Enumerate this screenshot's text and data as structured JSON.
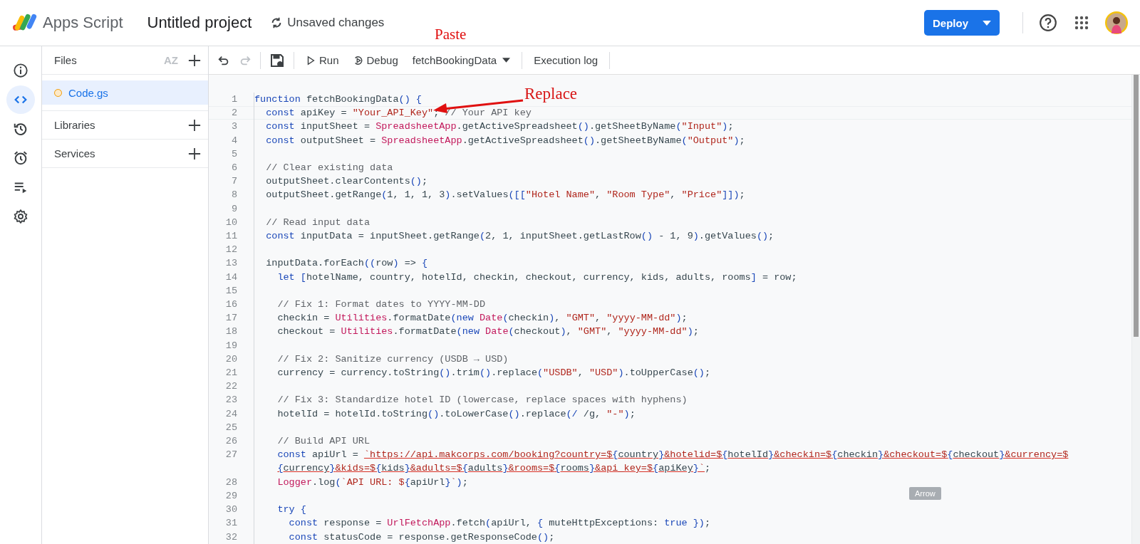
{
  "header": {
    "app_name": "Apps Script",
    "project_title": "Untitled project",
    "save_status": "Unsaved changes",
    "deploy_button": "Deploy"
  },
  "rail": [
    {
      "kind": "info",
      "selected": false
    },
    {
      "kind": "code",
      "selected": true
    },
    {
      "kind": "history",
      "selected": false
    },
    {
      "kind": "triggers",
      "selected": false
    },
    {
      "kind": "executions",
      "selected": false
    },
    {
      "kind": "settings",
      "selected": false
    }
  ],
  "files_panel": {
    "title": "Files",
    "sort_label": "AZ",
    "files": [
      {
        "name": "Code.gs",
        "selected": true
      }
    ],
    "sections": [
      {
        "label": "Libraries"
      },
      {
        "label": "Services"
      }
    ]
  },
  "toolbar": {
    "undo_disabled": false,
    "redo_disabled": true,
    "run": "Run",
    "debug": "Debug",
    "function_select": "fetchBookingData",
    "execution_log": "Execution log"
  },
  "code_lines": [
    {
      "number": "1",
      "current": false,
      "rows": [
        [
          {
            "kind": "keyword",
            "text": "function "
          },
          {
            "kind": "plain",
            "text": "fetchBookingData"
          },
          {
            "kind": "brace",
            "text": "() {"
          }
        ]
      ]
    },
    {
      "number": "2",
      "current": true,
      "rows": [
        [
          {
            "kind": "plain",
            "text": "  "
          },
          {
            "kind": "keyword",
            "text": "const "
          },
          {
            "kind": "plain",
            "text": "apiKey = "
          },
          {
            "kind": "string",
            "text": "\"Your_API_Key\""
          },
          {
            "kind": "plain",
            "text": "; "
          },
          {
            "kind": "comment",
            "text": "// Your API key"
          }
        ]
      ]
    },
    {
      "number": "3",
      "current": false,
      "rows": [
        [
          {
            "kind": "plain",
            "text": "  "
          },
          {
            "kind": "keyword",
            "text": "const "
          },
          {
            "kind": "plain",
            "text": "inputSheet = "
          },
          {
            "kind": "class",
            "text": "SpreadsheetApp"
          },
          {
            "kind": "plain",
            "text": ".getActiveSpreadsheet"
          },
          {
            "kind": "brace",
            "text": "()"
          },
          {
            "kind": "plain",
            "text": ".getSheetByName"
          },
          {
            "kind": "brace",
            "text": "("
          },
          {
            "kind": "string",
            "text": "\"Input\""
          },
          {
            "kind": "brace",
            "text": ")"
          },
          {
            "kind": "plain",
            "text": ";"
          }
        ]
      ]
    },
    {
      "number": "4",
      "current": false,
      "rows": [
        [
          {
            "kind": "plain",
            "text": "  "
          },
          {
            "kind": "keyword",
            "text": "const "
          },
          {
            "kind": "plain",
            "text": "outputSheet = "
          },
          {
            "kind": "class",
            "text": "SpreadsheetApp"
          },
          {
            "kind": "plain",
            "text": ".getActiveSpreadsheet"
          },
          {
            "kind": "brace",
            "text": "()"
          },
          {
            "kind": "plain",
            "text": ".getSheetByName"
          },
          {
            "kind": "brace",
            "text": "("
          },
          {
            "kind": "string",
            "text": "\"Output\""
          },
          {
            "kind": "brace",
            "text": ")"
          },
          {
            "kind": "plain",
            "text": ";"
          }
        ]
      ]
    },
    {
      "number": "5",
      "current": false
    },
    {
      "number": "6",
      "current": false,
      "rows": [
        [
          {
            "kind": "plain",
            "text": "  "
          },
          {
            "kind": "comment",
            "text": "// Clear existing data"
          }
        ]
      ]
    },
    {
      "number": "7",
      "current": false,
      "rows": [
        [
          {
            "kind": "plain",
            "text": "  outputSheet.clearContents"
          },
          {
            "kind": "brace",
            "text": "()"
          },
          {
            "kind": "plain",
            "text": ";"
          }
        ]
      ]
    },
    {
      "number": "8",
      "current": false,
      "rows": [
        [
          {
            "kind": "plain",
            "text": "  outputSheet.getRange"
          },
          {
            "kind": "brace",
            "text": "("
          },
          {
            "kind": "plain",
            "text": "1, 1, 1, 3"
          },
          {
            "kind": "brace",
            "text": ")"
          },
          {
            "kind": "plain",
            "text": ".setValues"
          },
          {
            "kind": "brace",
            "text": "([["
          },
          {
            "kind": "string",
            "text": "\"Hotel Name\""
          },
          {
            "kind": "plain",
            "text": ", "
          },
          {
            "kind": "string",
            "text": "\"Room Type\""
          },
          {
            "kind": "plain",
            "text": ", "
          },
          {
            "kind": "string",
            "text": "\"Price\""
          },
          {
            "kind": "brace",
            "text": "]])"
          },
          {
            "kind": "plain",
            "text": ";"
          }
        ]
      ]
    },
    {
      "number": "9",
      "current": false
    },
    {
      "number": "10",
      "current": false,
      "rows": [
        [
          {
            "kind": "plain",
            "text": "  "
          },
          {
            "kind": "comment",
            "text": "// Read input data"
          }
        ]
      ]
    },
    {
      "number": "11",
      "current": false,
      "rows": [
        [
          {
            "kind": "plain",
            "text": "  "
          },
          {
            "kind": "keyword",
            "text": "const "
          },
          {
            "kind": "plain",
            "text": "inputData = inputSheet.getRange"
          },
          {
            "kind": "brace",
            "text": "("
          },
          {
            "kind": "plain",
            "text": "2, 1, inputSheet.getLastRow"
          },
          {
            "kind": "brace",
            "text": "()"
          },
          {
            "kind": "plain",
            "text": " - 1, 9"
          },
          {
            "kind": "brace",
            "text": ")"
          },
          {
            "kind": "plain",
            "text": ".getValues"
          },
          {
            "kind": "brace",
            "text": "()"
          },
          {
            "kind": "plain",
            "text": ";"
          }
        ]
      ]
    },
    {
      "number": "12",
      "current": false
    },
    {
      "number": "13",
      "current": false,
      "rows": [
        [
          {
            "kind": "plain",
            "text": "  inputData.forEach"
          },
          {
            "kind": "brace",
            "text": "(("
          },
          {
            "kind": "plain",
            "text": "row"
          },
          {
            "kind": "brace",
            "text": ")"
          },
          {
            "kind": "plain",
            "text": " => "
          },
          {
            "kind": "brace",
            "text": "{"
          }
        ]
      ]
    },
    {
      "number": "14",
      "current": false,
      "rows": [
        [
          {
            "kind": "plain",
            "text": "    "
          },
          {
            "kind": "keyword",
            "text": "let "
          },
          {
            "kind": "brace",
            "text": "["
          },
          {
            "kind": "plain",
            "text": "hotelName, country, hotelId, checkin, checkout, currency, kids, adults, rooms"
          },
          {
            "kind": "brace",
            "text": "]"
          },
          {
            "kind": "plain",
            "text": " = row;"
          }
        ]
      ]
    },
    {
      "number": "15",
      "current": false
    },
    {
      "number": "16",
      "current": false,
      "rows": [
        [
          {
            "kind": "plain",
            "text": "    "
          },
          {
            "kind": "comment",
            "text": "// Fix 1: Format dates to YYYY-MM-DD"
          }
        ]
      ]
    },
    {
      "number": "17",
      "current": false,
      "rows": [
        [
          {
            "kind": "plain",
            "text": "    checkin = "
          },
          {
            "kind": "class",
            "text": "Utilities"
          },
          {
            "kind": "plain",
            "text": ".formatDate"
          },
          {
            "kind": "brace",
            "text": "("
          },
          {
            "kind": "keyword",
            "text": "new "
          },
          {
            "kind": "class",
            "text": "Date"
          },
          {
            "kind": "brace",
            "text": "("
          },
          {
            "kind": "plain",
            "text": "checkin"
          },
          {
            "kind": "brace",
            "text": ")"
          },
          {
            "kind": "plain",
            "text": ", "
          },
          {
            "kind": "string",
            "text": "\"GMT\""
          },
          {
            "kind": "plain",
            "text": ", "
          },
          {
            "kind": "string",
            "text": "\"yyyy-MM-dd\""
          },
          {
            "kind": "brace",
            "text": ")"
          },
          {
            "kind": "plain",
            "text": ";"
          }
        ]
      ]
    },
    {
      "number": "18",
      "current": false,
      "rows": [
        [
          {
            "kind": "plain",
            "text": "    checkout = "
          },
          {
            "kind": "class",
            "text": "Utilities"
          },
          {
            "kind": "plain",
            "text": ".formatDate"
          },
          {
            "kind": "brace",
            "text": "("
          },
          {
            "kind": "keyword",
            "text": "new "
          },
          {
            "kind": "class",
            "text": "Date"
          },
          {
            "kind": "brace",
            "text": "("
          },
          {
            "kind": "plain",
            "text": "checkout"
          },
          {
            "kind": "brace",
            "text": ")"
          },
          {
            "kind": "plain",
            "text": ", "
          },
          {
            "kind": "string",
            "text": "\"GMT\""
          },
          {
            "kind": "plain",
            "text": ", "
          },
          {
            "kind": "string",
            "text": "\"yyyy-MM-dd\""
          },
          {
            "kind": "brace",
            "text": ")"
          },
          {
            "kind": "plain",
            "text": ";"
          }
        ]
      ]
    },
    {
      "number": "19",
      "current": false
    },
    {
      "number": "20",
      "current": false,
      "rows": [
        [
          {
            "kind": "plain",
            "text": "    "
          },
          {
            "kind": "comment",
            "text": "// Fix 2: Sanitize currency (USDB → USD)"
          }
        ]
      ]
    },
    {
      "number": "21",
      "current": false,
      "rows": [
        [
          {
            "kind": "plain",
            "text": "    currency = currency.toString"
          },
          {
            "kind": "brace",
            "text": "()"
          },
          {
            "kind": "plain",
            "text": ".trim"
          },
          {
            "kind": "brace",
            "text": "()"
          },
          {
            "kind": "plain",
            "text": ".replace"
          },
          {
            "kind": "brace",
            "text": "("
          },
          {
            "kind": "string",
            "text": "\"USDB\""
          },
          {
            "kind": "plain",
            "text": ", "
          },
          {
            "kind": "string",
            "text": "\"USD\""
          },
          {
            "kind": "brace",
            "text": ")"
          },
          {
            "kind": "plain",
            "text": ".toUpperCase"
          },
          {
            "kind": "brace",
            "text": "()"
          },
          {
            "kind": "plain",
            "text": ";"
          }
        ]
      ]
    },
    {
      "number": "22",
      "current": false
    },
    {
      "number": "23",
      "current": false,
      "rows": [
        [
          {
            "kind": "plain",
            "text": "    "
          },
          {
            "kind": "comment",
            "text": "// Fix 3: Standardize hotel ID (lowercase, replace spaces with hyphens)"
          }
        ]
      ]
    },
    {
      "number": "24",
      "current": false,
      "rows": [
        [
          {
            "kind": "plain",
            "text": "    hotelId = hotelId.toString"
          },
          {
            "kind": "brace",
            "text": "()"
          },
          {
            "kind": "plain",
            "text": ".toLowerCase"
          },
          {
            "kind": "brace",
            "text": "()"
          },
          {
            "kind": "plain",
            "text": ".replace"
          },
          {
            "kind": "brace",
            "text": "("
          },
          {
            "kind": "brace",
            "text": "/"
          },
          {
            "kind": "plain",
            "text": " /g, "
          },
          {
            "kind": "string",
            "text": "\"-\""
          },
          {
            "kind": "brace",
            "text": ")"
          },
          {
            "kind": "plain",
            "text": ";"
          }
        ]
      ]
    },
    {
      "number": "25",
      "current": false
    },
    {
      "number": "26",
      "current": false,
      "rows": [
        [
          {
            "kind": "plain",
            "text": "    "
          },
          {
            "kind": "comment",
            "text": "// Build API URL"
          }
        ]
      ]
    },
    {
      "number": "27",
      "current": false,
      "segments": [
        {
          "kind": "keyword",
          "text": "    const "
        },
        {
          "kind": "plain",
          "text": "apiUrl = "
        },
        {
          "kind": "url",
          "text": "`https://api.makcorps.com/booking?country=$"
        },
        {
          "kind": "urlbrace",
          "text": "{"
        },
        {
          "kind": "urlvar",
          "text": "country"
        },
        {
          "kind": "urlbrace",
          "text": "}"
        },
        {
          "kind": "url",
          "text": "&hotelid=$"
        },
        {
          "kind": "urlbrace",
          "text": "{"
        },
        {
          "kind": "urlvar",
          "text": "hotelId"
        },
        {
          "kind": "urlbrace",
          "text": "}"
        },
        {
          "kind": "url",
          "text": "&checkin=$"
        },
        {
          "kind": "urlbrace",
          "text": "{"
        },
        {
          "kind": "urlvar",
          "text": "checkin"
        },
        {
          "kind": "urlbrace",
          "text": "}"
        },
        {
          "kind": "url",
          "text": "&checkout=$"
        },
        {
          "kind": "urlbrace",
          "text": "{"
        },
        {
          "kind": "urlvar",
          "text": "checkout"
        },
        {
          "kind": "urlbrace",
          "text": "}"
        },
        {
          "kind": "url",
          "text": "&currency=$"
        },
        {
          "kind": "wrap"
        },
        {
          "kind": "urlbrace",
          "text": "{"
        },
        {
          "kind": "urlvar",
          "text": "currency"
        },
        {
          "kind": "urlbrace",
          "text": "}"
        },
        {
          "kind": "url",
          "text": "&kids=$"
        },
        {
          "kind": "urlbrace",
          "text": "{"
        },
        {
          "kind": "urlvar",
          "text": "kids"
        },
        {
          "kind": "urlbrace",
          "text": "}"
        },
        {
          "kind": "url",
          "text": "&adults=$"
        },
        {
          "kind": "urlbrace",
          "text": "{"
        },
        {
          "kind": "urlvar",
          "text": "adults"
        },
        {
          "kind": "urlbrace",
          "text": "}"
        },
        {
          "kind": "url",
          "text": "&rooms=$"
        },
        {
          "kind": "urlbrace",
          "text": "{"
        },
        {
          "kind": "urlvar",
          "text": "rooms"
        },
        {
          "kind": "urlbrace",
          "text": "}"
        },
        {
          "kind": "url",
          "text": "&api_key=$"
        },
        {
          "kind": "urlbrace",
          "text": "{"
        },
        {
          "kind": "urlvar",
          "text": "apiKey"
        },
        {
          "kind": "urlbrace",
          "text": "}"
        },
        {
          "kind": "url",
          "text": "`"
        },
        {
          "kind": "plain",
          "text": ";"
        }
      ]
    },
    {
      "number": "28",
      "current": false,
      "rows": [
        [
          {
            "kind": "plain",
            "text": "    "
          },
          {
            "kind": "class",
            "text": "Logger"
          },
          {
            "kind": "plain",
            "text": ".log"
          },
          {
            "kind": "brace",
            "text": "("
          },
          {
            "kind": "string",
            "text": "`API URL: $"
          },
          {
            "kind": "brace",
            "text": "{"
          },
          {
            "kind": "plain",
            "text": "apiUrl"
          },
          {
            "kind": "brace",
            "text": "}"
          },
          {
            "kind": "string",
            "text": "`"
          },
          {
            "kind": "brace",
            "text": ")"
          },
          {
            "kind": "plain",
            "text": ";"
          }
        ]
      ]
    },
    {
      "number": "29",
      "current": false
    },
    {
      "number": "30",
      "current": false,
      "rows": [
        [
          {
            "kind": "plain",
            "text": "    "
          },
          {
            "kind": "keyword",
            "text": "try "
          },
          {
            "kind": "brace",
            "text": "{"
          }
        ]
      ]
    },
    {
      "number": "31",
      "current": false,
      "rows": [
        [
          {
            "kind": "plain",
            "text": "      "
          },
          {
            "kind": "keyword",
            "text": "const "
          },
          {
            "kind": "plain",
            "text": "response = "
          },
          {
            "kind": "class",
            "text": "UrlFetchApp"
          },
          {
            "kind": "plain",
            "text": ".fetch"
          },
          {
            "kind": "brace",
            "text": "("
          },
          {
            "kind": "plain",
            "text": "apiUrl, "
          },
          {
            "kind": "brace",
            "text": "{"
          },
          {
            "kind": "plain",
            "text": " muteHttpExceptions: "
          },
          {
            "kind": "keyword",
            "text": "true "
          },
          {
            "kind": "brace",
            "text": "})"
          },
          {
            "kind": "plain",
            "text": ";"
          }
        ]
      ]
    },
    {
      "number": "32",
      "current": false,
      "rows": [
        [
          {
            "kind": "plain",
            "text": "      "
          },
          {
            "kind": "keyword",
            "text": "const "
          },
          {
            "kind": "plain",
            "text": "statusCode = response.getResponseCode"
          },
          {
            "kind": "brace",
            "text": "()"
          },
          {
            "kind": "plain",
            "text": ";"
          }
        ]
      ]
    }
  ],
  "annotations": [
    {
      "kind": "label",
      "text": "Paste"
    },
    {
      "kind": "arrow_label",
      "text": "Replace"
    }
  ],
  "tooltip": "Arrow"
}
